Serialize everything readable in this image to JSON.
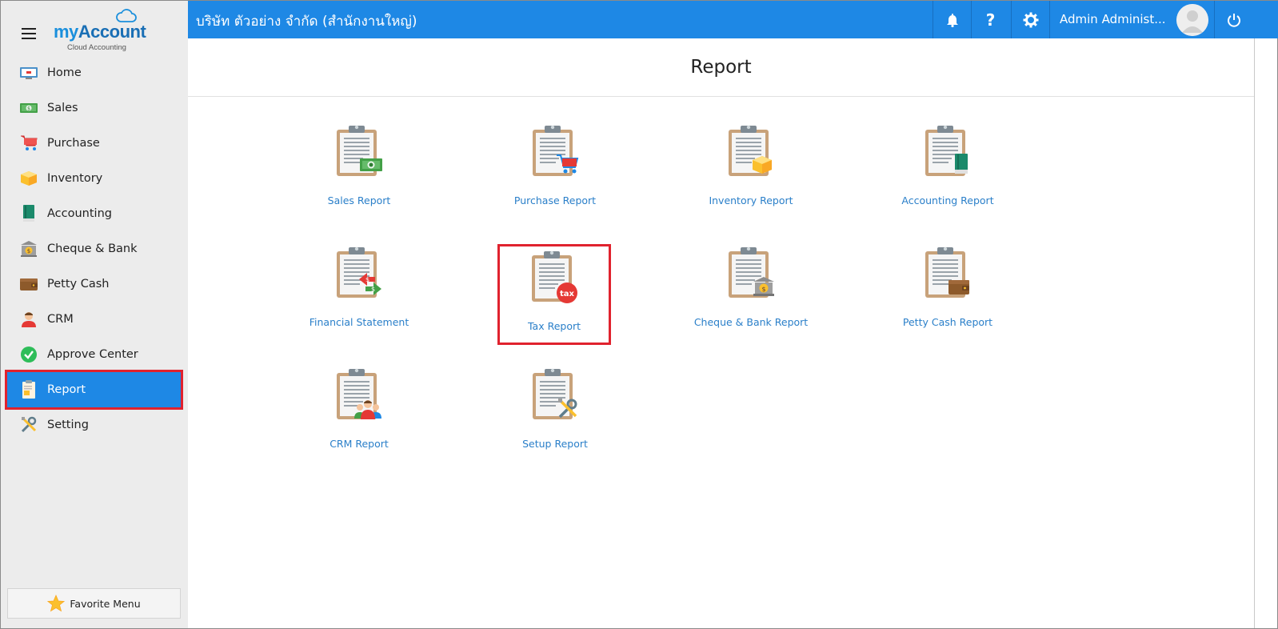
{
  "app": {
    "logo_my": "my",
    "logo_account": "Account",
    "logo_sub": "Cloud Accounting"
  },
  "sidebar": {
    "items": [
      {
        "label": "Home",
        "icon": "home-icon"
      },
      {
        "label": "Sales",
        "icon": "money-icon"
      },
      {
        "label": "Purchase",
        "icon": "cart-icon"
      },
      {
        "label": "Inventory",
        "icon": "box-icon"
      },
      {
        "label": "Accounting",
        "icon": "book-icon"
      },
      {
        "label": "Cheque & Bank",
        "icon": "bank-icon"
      },
      {
        "label": "Petty Cash",
        "icon": "wallet-icon"
      },
      {
        "label": "CRM",
        "icon": "people-icon"
      },
      {
        "label": "Approve Center",
        "icon": "check-circle-icon"
      },
      {
        "label": "Report",
        "icon": "report-icon"
      },
      {
        "label": "Setting",
        "icon": "tools-icon"
      }
    ],
    "active": "Report",
    "favorite_label": "Favorite Menu"
  },
  "topbar": {
    "company": "บริษัท ตัวอย่าง จำกัด (สำนักงานใหญ่)",
    "user_name": "Admin Administ...",
    "accent": "#1e88e5"
  },
  "main": {
    "title": "Report",
    "reports": [
      {
        "label": "Sales Report",
        "badge": "money"
      },
      {
        "label": "Purchase Report",
        "badge": "cart"
      },
      {
        "label": "Inventory Report",
        "badge": "box"
      },
      {
        "label": "Accounting Report",
        "badge": "book"
      },
      {
        "label": "Financial Statement",
        "badge": "exchange"
      },
      {
        "label": "Tax Report",
        "badge": "tax",
        "badge_text": "tax"
      },
      {
        "label": "Cheque & Bank Report",
        "badge": "bank"
      },
      {
        "label": "Petty Cash Report",
        "badge": "wallet"
      },
      {
        "label": "CRM Report",
        "badge": "people"
      },
      {
        "label": "Setup Report",
        "badge": "tools"
      }
    ],
    "highlighted": "Tax Report"
  }
}
